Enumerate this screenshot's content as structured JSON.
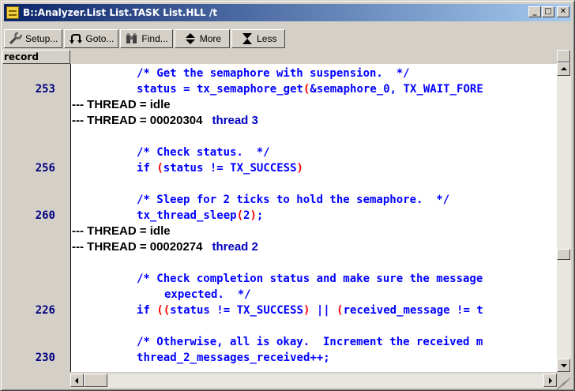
{
  "window": {
    "title": "B::Analyzer.List List.TASK List.HLL /t",
    "controls": {
      "minimize": "_",
      "maximize": "□",
      "close": "✕"
    }
  },
  "toolbar": {
    "setup": {
      "label": "Setup...",
      "icon": "wrench-icon"
    },
    "goto": {
      "label": "Goto...",
      "icon": "goto-arrow-icon"
    },
    "find": {
      "label": "Find...",
      "icon": "binoculars-icon"
    },
    "more": {
      "label": "More",
      "icon": "up-down-arrow-icon"
    },
    "less": {
      "label": "Less",
      "icon": "hourglass-icon"
    }
  },
  "columns": {
    "record": "record"
  },
  "listing": [
    {
      "type": "code",
      "num": "",
      "text": "/* Get the semaphore with suspension.  */"
    },
    {
      "type": "code",
      "num": "253",
      "text": "status = tx_semaphore_get(&semaphore_0, TX_WAIT_FORE"
    },
    {
      "type": "thread",
      "text": "--- THREAD = idle",
      "thread_name": ""
    },
    {
      "type": "thread",
      "text": "--- THREAD = 00020304",
      "thread_name": "thread 3"
    },
    {
      "type": "blank"
    },
    {
      "type": "code",
      "num": "",
      "text": "/* Check status.  */"
    },
    {
      "type": "code",
      "num": "256",
      "text": "if (status != TX_SUCCESS)"
    },
    {
      "type": "blank"
    },
    {
      "type": "code",
      "num": "",
      "text": "/* Sleep for 2 ticks to hold the semaphore.  */"
    },
    {
      "type": "code",
      "num": "260",
      "text": "tx_thread_sleep(2);"
    },
    {
      "type": "thread",
      "text": "--- THREAD = idle",
      "thread_name": ""
    },
    {
      "type": "thread",
      "text": "--- THREAD = 00020274",
      "thread_name": "thread 2"
    },
    {
      "type": "blank"
    },
    {
      "type": "code",
      "num": "",
      "text": "/* Check completion status and make sure the message"
    },
    {
      "type": "cont",
      "num": "",
      "text": "expected.  */"
    },
    {
      "type": "code",
      "num": "226",
      "text": "if ((status != TX_SUCCESS) || (received_message != t"
    },
    {
      "type": "blank"
    },
    {
      "type": "code",
      "num": "",
      "text": "/* Otherwise, all is okay.  Increment the received m"
    },
    {
      "type": "code",
      "num": "230",
      "text": "thread_2_messages_received++;"
    }
  ],
  "colors": {
    "title_start": "#0a246a",
    "title_end": "#a6caf0",
    "code": "#0000ff",
    "line_number": "#000080",
    "paren_highlight": "#ff0000",
    "thread_text": "#000000",
    "face": "#d4d0c8"
  }
}
